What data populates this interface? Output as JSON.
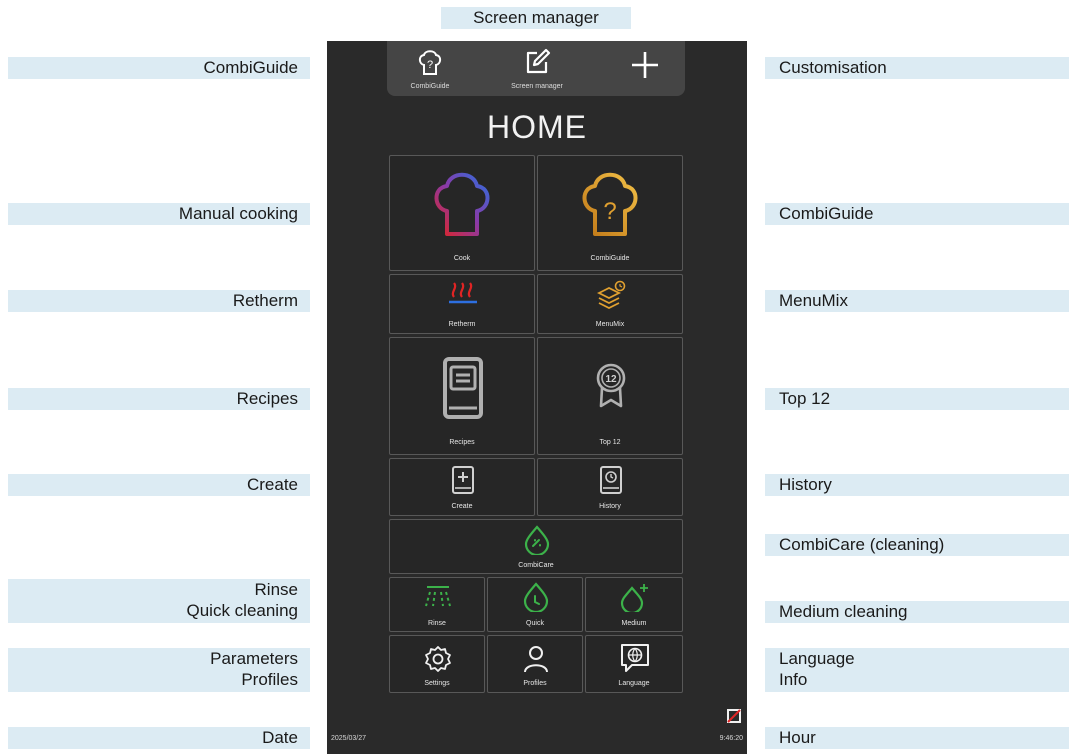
{
  "annotations": {
    "top": "Screen manager",
    "left": {
      "combiguide": "CombiGuide",
      "manual_cooking": "Manual cooking",
      "retherm": "Retherm",
      "recipes": "Recipes",
      "create": "Create",
      "rinse": "Rinse",
      "quick_cleaning": "Quick cleaning",
      "parameters": "Parameters",
      "profiles": "Profiles",
      "date": "Date"
    },
    "right": {
      "customisation": "Customisation",
      "combiguide": "CombiGuide",
      "menumix": "MenuMix",
      "top12": "Top 12",
      "history": "History",
      "combicare": "CombiCare (cleaning)",
      "medium_cleaning": "Medium cleaning",
      "language": "Language",
      "info": "Info",
      "hour": "Hour"
    }
  },
  "device": {
    "topbar": {
      "combiguide_label": "CombiGuide",
      "screen_manager_label": "Screen manager"
    },
    "title": "HOME",
    "tiles": {
      "cook": "Cook",
      "combiguide": "CombiGuide",
      "retherm": "Retherm",
      "menumix": "MenuMix",
      "recipes": "Recipes",
      "top12": "Top 12",
      "top12_badge": "12",
      "create": "Create",
      "history": "History",
      "combicare": "CombiCare",
      "rinse": "Rinse",
      "quick": "Quick",
      "medium": "Medium",
      "settings": "Settings",
      "profiles": "Profiles",
      "language": "Language"
    },
    "date": "2025/03/27",
    "time": "9:46:20"
  },
  "icons": [
    "chef-hat-question-icon",
    "edit-icon",
    "plus-icon",
    "chef-hat-icon",
    "retherm-waves-icon",
    "menumix-stack-icon",
    "recipe-book-icon",
    "ribbon-badge-icon",
    "create-book-icon",
    "history-book-icon",
    "combicare-drop-icon",
    "rinse-spray-icon",
    "quick-clean-drop-icon",
    "medium-clean-drop-icon",
    "gear-icon",
    "user-icon",
    "language-globe-icon",
    "no-image-icon"
  ],
  "colors": {
    "screen_bg": "#2a2a2a",
    "label_bg": "#dcebf3",
    "accent_gold": "#e0a030",
    "accent_green": "#3cb24a",
    "accent_red": "#e02424",
    "accent_blue": "#2d6fe0"
  }
}
